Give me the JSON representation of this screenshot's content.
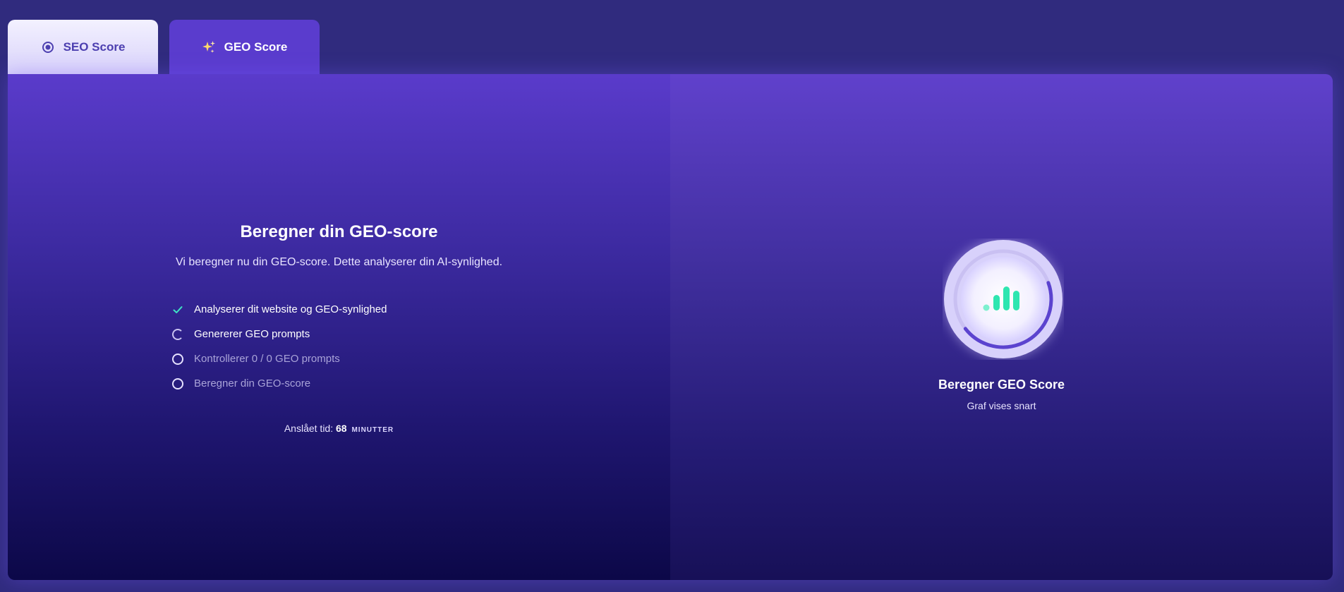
{
  "tabs": [
    {
      "label": "SEO Score",
      "icon": "radio-target-icon"
    },
    {
      "label": "GEO Score",
      "icon": "sparkles-icon"
    }
  ],
  "main": {
    "title": "Beregner din GEO-score",
    "subtitle": "Vi beregner nu din GEO-score. Dette analyserer din AI-synlighed.",
    "steps": [
      {
        "label": "Analyserer dit website og GEO-synlighed",
        "status": "done"
      },
      {
        "label": "Genererer GEO prompts",
        "status": "in-progress"
      },
      {
        "label": "Kontrollerer 0 / 0 GEO prompts",
        "status": "pending"
      },
      {
        "label": "Beregner din GEO-score",
        "status": "pending"
      }
    ],
    "eta": {
      "label": "Anslået tid:",
      "value": "68",
      "unit": "MINUTTER"
    }
  },
  "gauge": {
    "title": "Beregner GEO Score",
    "subtitle": "Graf vises snart",
    "progress": 0.45,
    "icon": "bar-chart-icon"
  },
  "colors": {
    "accent": "#5a3ccd",
    "check": "#3fe3c4",
    "bars": "#2ee6b0",
    "background": "#302b7e"
  }
}
